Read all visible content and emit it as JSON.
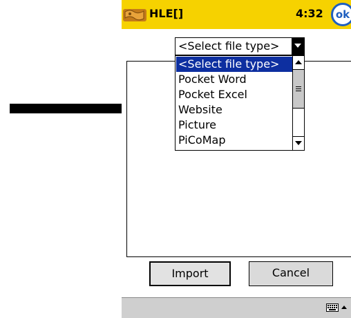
{
  "titlebar": {
    "app_title": "HLE[]",
    "clock": "4:32",
    "ok_label": "ok",
    "color": "#f6d200"
  },
  "file_type_select": {
    "selected": "<Select file type>",
    "options": [
      "<Select file type>",
      "Pocket Word",
      "Pocket Excel",
      "Website",
      "Picture",
      "PiCoMap"
    ],
    "highlight_color": "#0d2fa0"
  },
  "buttons": {
    "import_label": "Import",
    "cancel_label": "Cancel"
  },
  "bottom_bar": {
    "input_icon": "keyboard-icon"
  },
  "annotation": {
    "arrow": "arrow-pointing-at-website-option"
  }
}
